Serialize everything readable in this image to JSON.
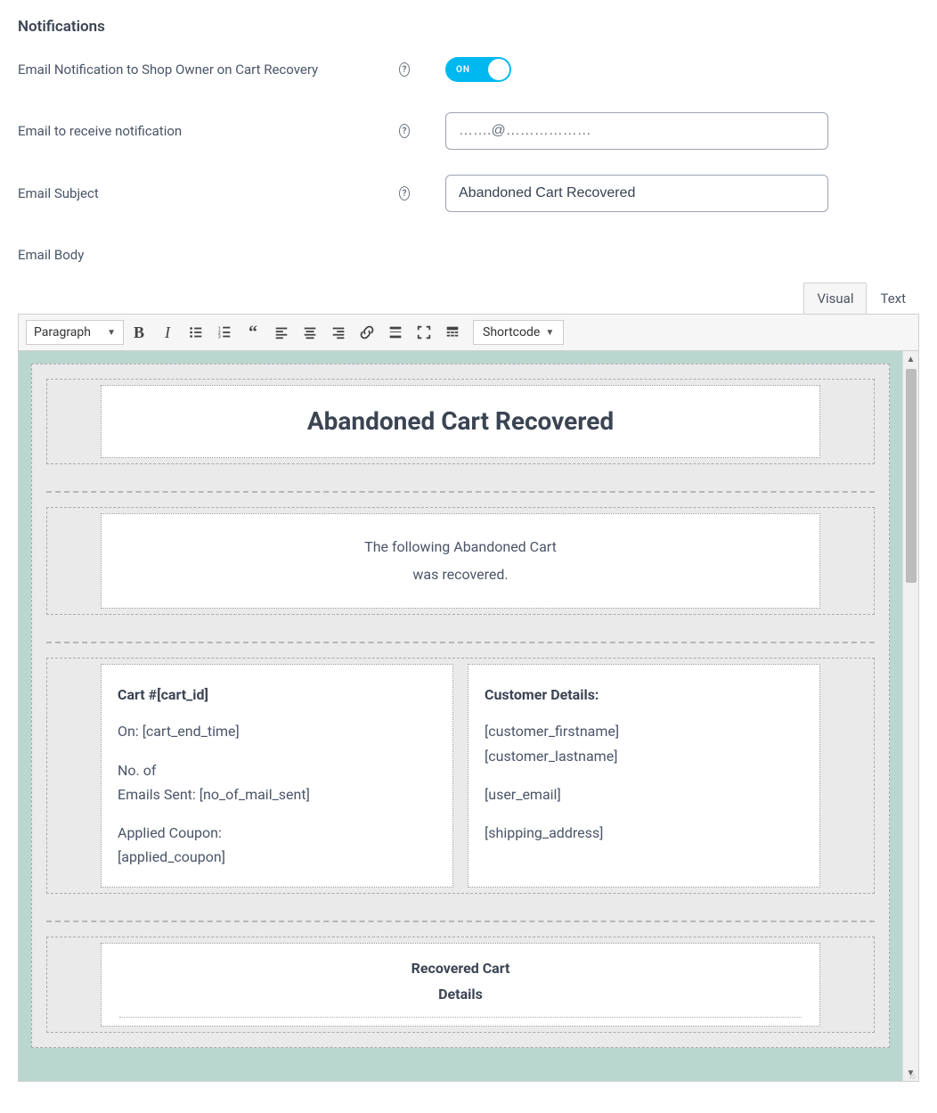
{
  "heading": "Notifications",
  "rows": {
    "toggle": {
      "label": "Email Notification to Shop Owner on Cart Recovery",
      "state": "ON"
    },
    "email": {
      "label": "Email to receive notification",
      "value": "…….@………………"
    },
    "subject": {
      "label": "Email Subject",
      "value": "Abandoned Cart Recovered"
    },
    "body": {
      "label": "Email Body"
    }
  },
  "tabs": {
    "visual": "Visual",
    "text": "Text"
  },
  "toolbar": {
    "format": "Paragraph",
    "shortcode": "Shortcode"
  },
  "mail": {
    "header": "Abandoned Cart Recovered",
    "intro1": "The following Abandoned Cart",
    "intro2": "was recovered.",
    "left": {
      "title": "Cart #[cart_id]",
      "l1": "On: [cart_end_time]",
      "l2": "No. of",
      "l3": "Emails Sent: [no_of_mail_sent]",
      "l4": "Applied Coupon:",
      "l5": "[applied_coupon]"
    },
    "right": {
      "title": "Customer Details:",
      "l1": "[customer_firstname]",
      "l2": "[customer_lastname]",
      "l3": "[user_email]",
      "l4": "[shipping_address]"
    },
    "recovered1": "Recovered Cart",
    "recovered2": "Details"
  }
}
